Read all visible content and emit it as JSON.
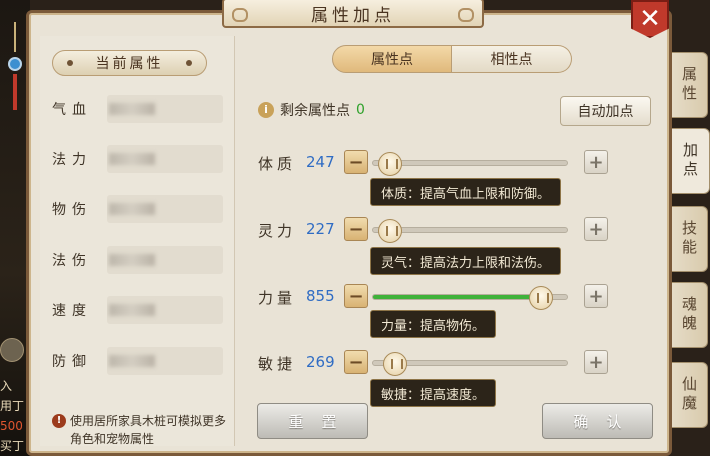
{
  "window": {
    "title": "属性加点",
    "close_glyph": "✕"
  },
  "outside": {
    "lines": [
      "入",
      "用丁",
      "500",
      "买丁"
    ],
    "accent": "#e0552f"
  },
  "left_panel": {
    "header": "当前属性",
    "stats": [
      {
        "label": "气血"
      },
      {
        "label": "法力"
      },
      {
        "label": "物伤"
      },
      {
        "label": "法伤"
      },
      {
        "label": "速度"
      },
      {
        "label": "防御"
      }
    ],
    "tip_icon": "!",
    "tip": "使用居所家具木桩可模拟更多角色和宠物属性"
  },
  "tabs": [
    {
      "label": "属性点",
      "active": true
    },
    {
      "label": "相性点",
      "active": false
    }
  ],
  "remaining": {
    "icon": "i",
    "label": "剩余属性点",
    "value": "0"
  },
  "auto_button": "自动加点",
  "attributes": [
    {
      "name": "体质",
      "value": "247",
      "slider_level": 0.03,
      "tooltip": "体质：提高气血上限和防御。"
    },
    {
      "name": "灵力",
      "value": "227",
      "slider_level": 0.03,
      "tooltip": "灵气：提高法力上限和法伤。"
    },
    {
      "name": "力量",
      "value": "855",
      "slider_level": 0.92,
      "tooltip": "力量：提高物伤。"
    },
    {
      "name": "敏捷",
      "value": "269",
      "slider_level": 0.06,
      "tooltip": "敏捷：提高速度。"
    }
  ],
  "buttons": {
    "minus": "−",
    "plus": "+",
    "reset": "重置",
    "confirm": "确认"
  },
  "side_tabs": [
    {
      "label": "属性",
      "active": false
    },
    {
      "label": "加点",
      "active": true
    },
    {
      "label": "技能",
      "active": false
    },
    {
      "label": "魂魄",
      "active": false
    },
    {
      "label": "仙魔",
      "active": false
    }
  ],
  "colors": {
    "value_blue": "#2f6cc4",
    "remaining_green": "#2fa12b",
    "slider_fill": "#3fb23a",
    "close_red": "#c0392b"
  }
}
